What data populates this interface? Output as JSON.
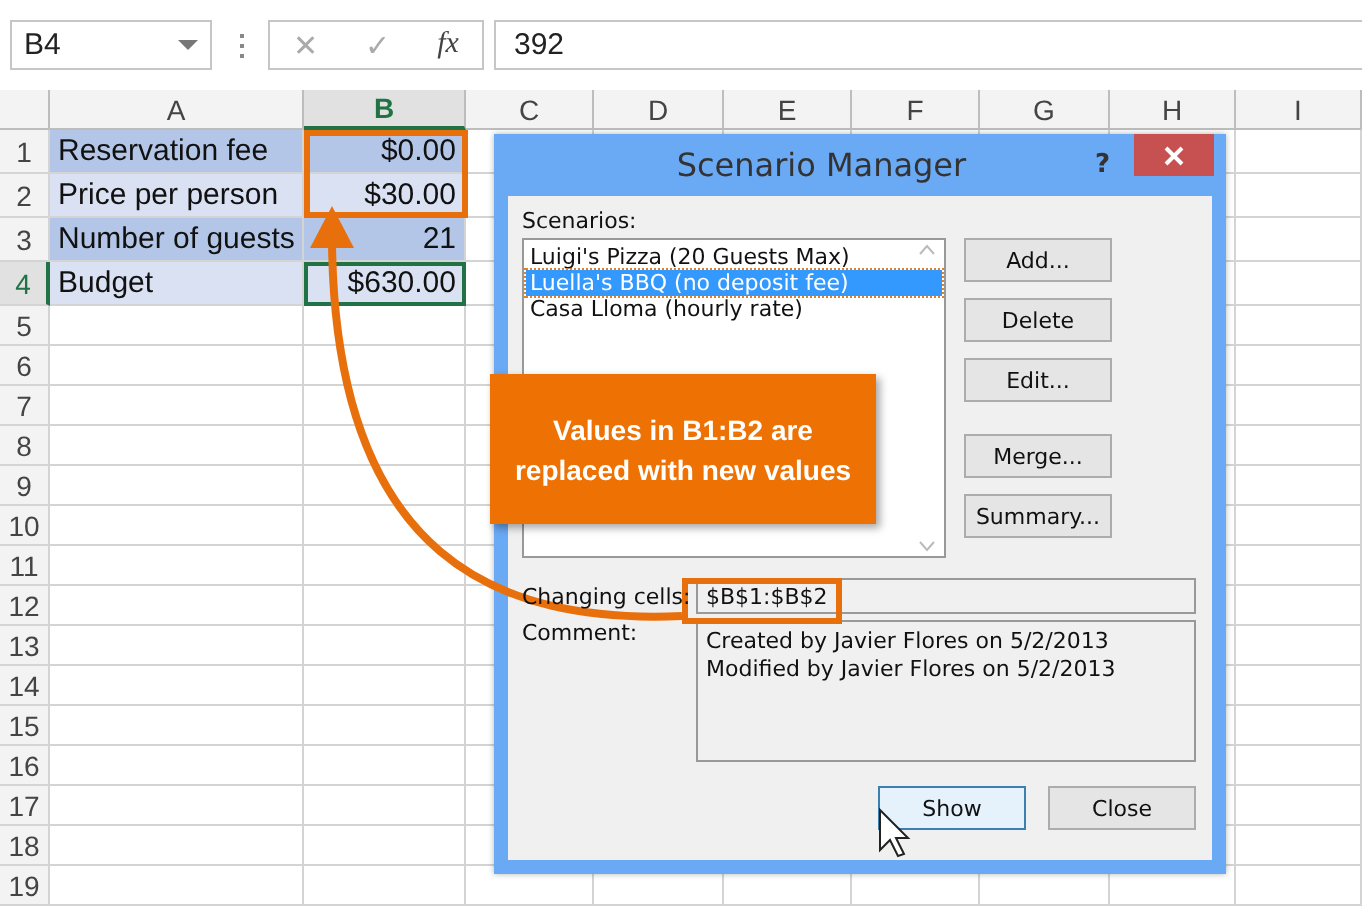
{
  "formula_bar": {
    "name_box": "B4",
    "cancel": "✕",
    "enter": "✓",
    "function": "fx",
    "formula": "392"
  },
  "columns": [
    {
      "label": "A",
      "selected": false
    },
    {
      "label": "B",
      "selected": true
    },
    {
      "label": "C",
      "selected": false
    },
    {
      "label": "D",
      "selected": false
    },
    {
      "label": "E",
      "selected": false
    },
    {
      "label": "F",
      "selected": false
    },
    {
      "label": "G",
      "selected": false
    },
    {
      "label": "H",
      "selected": false
    },
    {
      "label": "I",
      "selected": false
    }
  ],
  "rows": [
    {
      "number": "1",
      "a": "Reservation fee",
      "b": "$0.00",
      "selected": false
    },
    {
      "number": "2",
      "a": "Price per person",
      "b": "$30.00",
      "selected": false
    },
    {
      "number": "3",
      "a": "Number of guests",
      "b": "21",
      "selected": false
    },
    {
      "number": "4",
      "a": "Budget",
      "b": "$630.00",
      "selected": true
    },
    {
      "number": "5"
    },
    {
      "number": "6"
    },
    {
      "number": "7"
    },
    {
      "number": "8"
    },
    {
      "number": "9"
    },
    {
      "number": "10"
    },
    {
      "number": "11"
    },
    {
      "number": "12"
    },
    {
      "number": "13"
    },
    {
      "number": "14"
    },
    {
      "number": "15"
    },
    {
      "number": "16"
    },
    {
      "number": "17"
    },
    {
      "number": "18"
    },
    {
      "number": "19"
    }
  ],
  "dialog": {
    "title": "Scenario Manager",
    "help": "?",
    "scenarios_label": "Scenarios:",
    "scenarios": [
      {
        "label": "Luigi's Pizza (20 Guests Max)",
        "selected": false
      },
      {
        "label": "Luella's BBQ (no deposit fee)",
        "selected": true
      },
      {
        "label": "Casa Lloma (hourly rate)",
        "selected": false
      }
    ],
    "side_buttons": [
      "Add...",
      "Delete",
      "Edit...",
      "Merge...",
      "Summary..."
    ],
    "changing_cells_label": "Changing cells:",
    "changing_cells": "$B$1:$B$2",
    "comment_label": "Comment:",
    "comment": [
      "Created by Javier Flores on 5/2/2013",
      "Modified by Javier Flores on 5/2/2013"
    ],
    "footer_buttons": [
      {
        "label": "Show",
        "focused": true
      },
      {
        "label": "Close",
        "focused": false
      }
    ]
  },
  "callout": {
    "text": "Values in B1:B2 are replaced with new values"
  }
}
